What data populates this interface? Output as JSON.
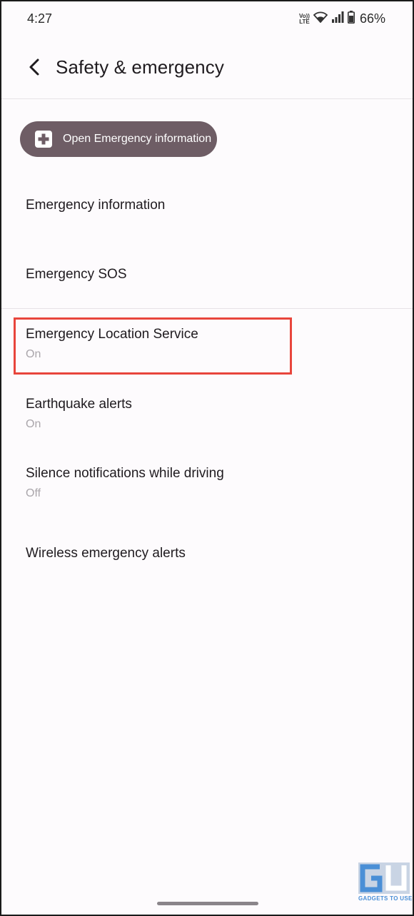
{
  "status_bar": {
    "time": "4:27",
    "volte_label": "Vo)) LTE",
    "battery_percent": "66%",
    "icons": [
      "volte-icon",
      "wifi-icon",
      "signal-icon",
      "battery-icon"
    ]
  },
  "header": {
    "back_icon": "arrow-left-icon",
    "title": "Safety & emergency"
  },
  "emergency_button": {
    "icon": "medical-plus-icon",
    "label": "Open Emergency information"
  },
  "settings": [
    {
      "title": "Emergency information",
      "summary": ""
    },
    {
      "title": "Emergency SOS",
      "summary": ""
    },
    {
      "title": "Emergency Location Service",
      "summary": "On"
    },
    {
      "title": "Earthquake alerts",
      "summary": "On"
    },
    {
      "title": "Silence notifications while driving",
      "summary": "Off"
    },
    {
      "title": "Wireless emergency alerts",
      "summary": ""
    }
  ],
  "watermark": {
    "logo_text": "GU",
    "caption": "GADGETS TO USE"
  },
  "colors": {
    "background": "#fdfbfd",
    "pill": "#6e5d65",
    "highlight": "#e8453c",
    "summary_text": "#aaa6ab",
    "watermark": "#4a8fd6"
  }
}
